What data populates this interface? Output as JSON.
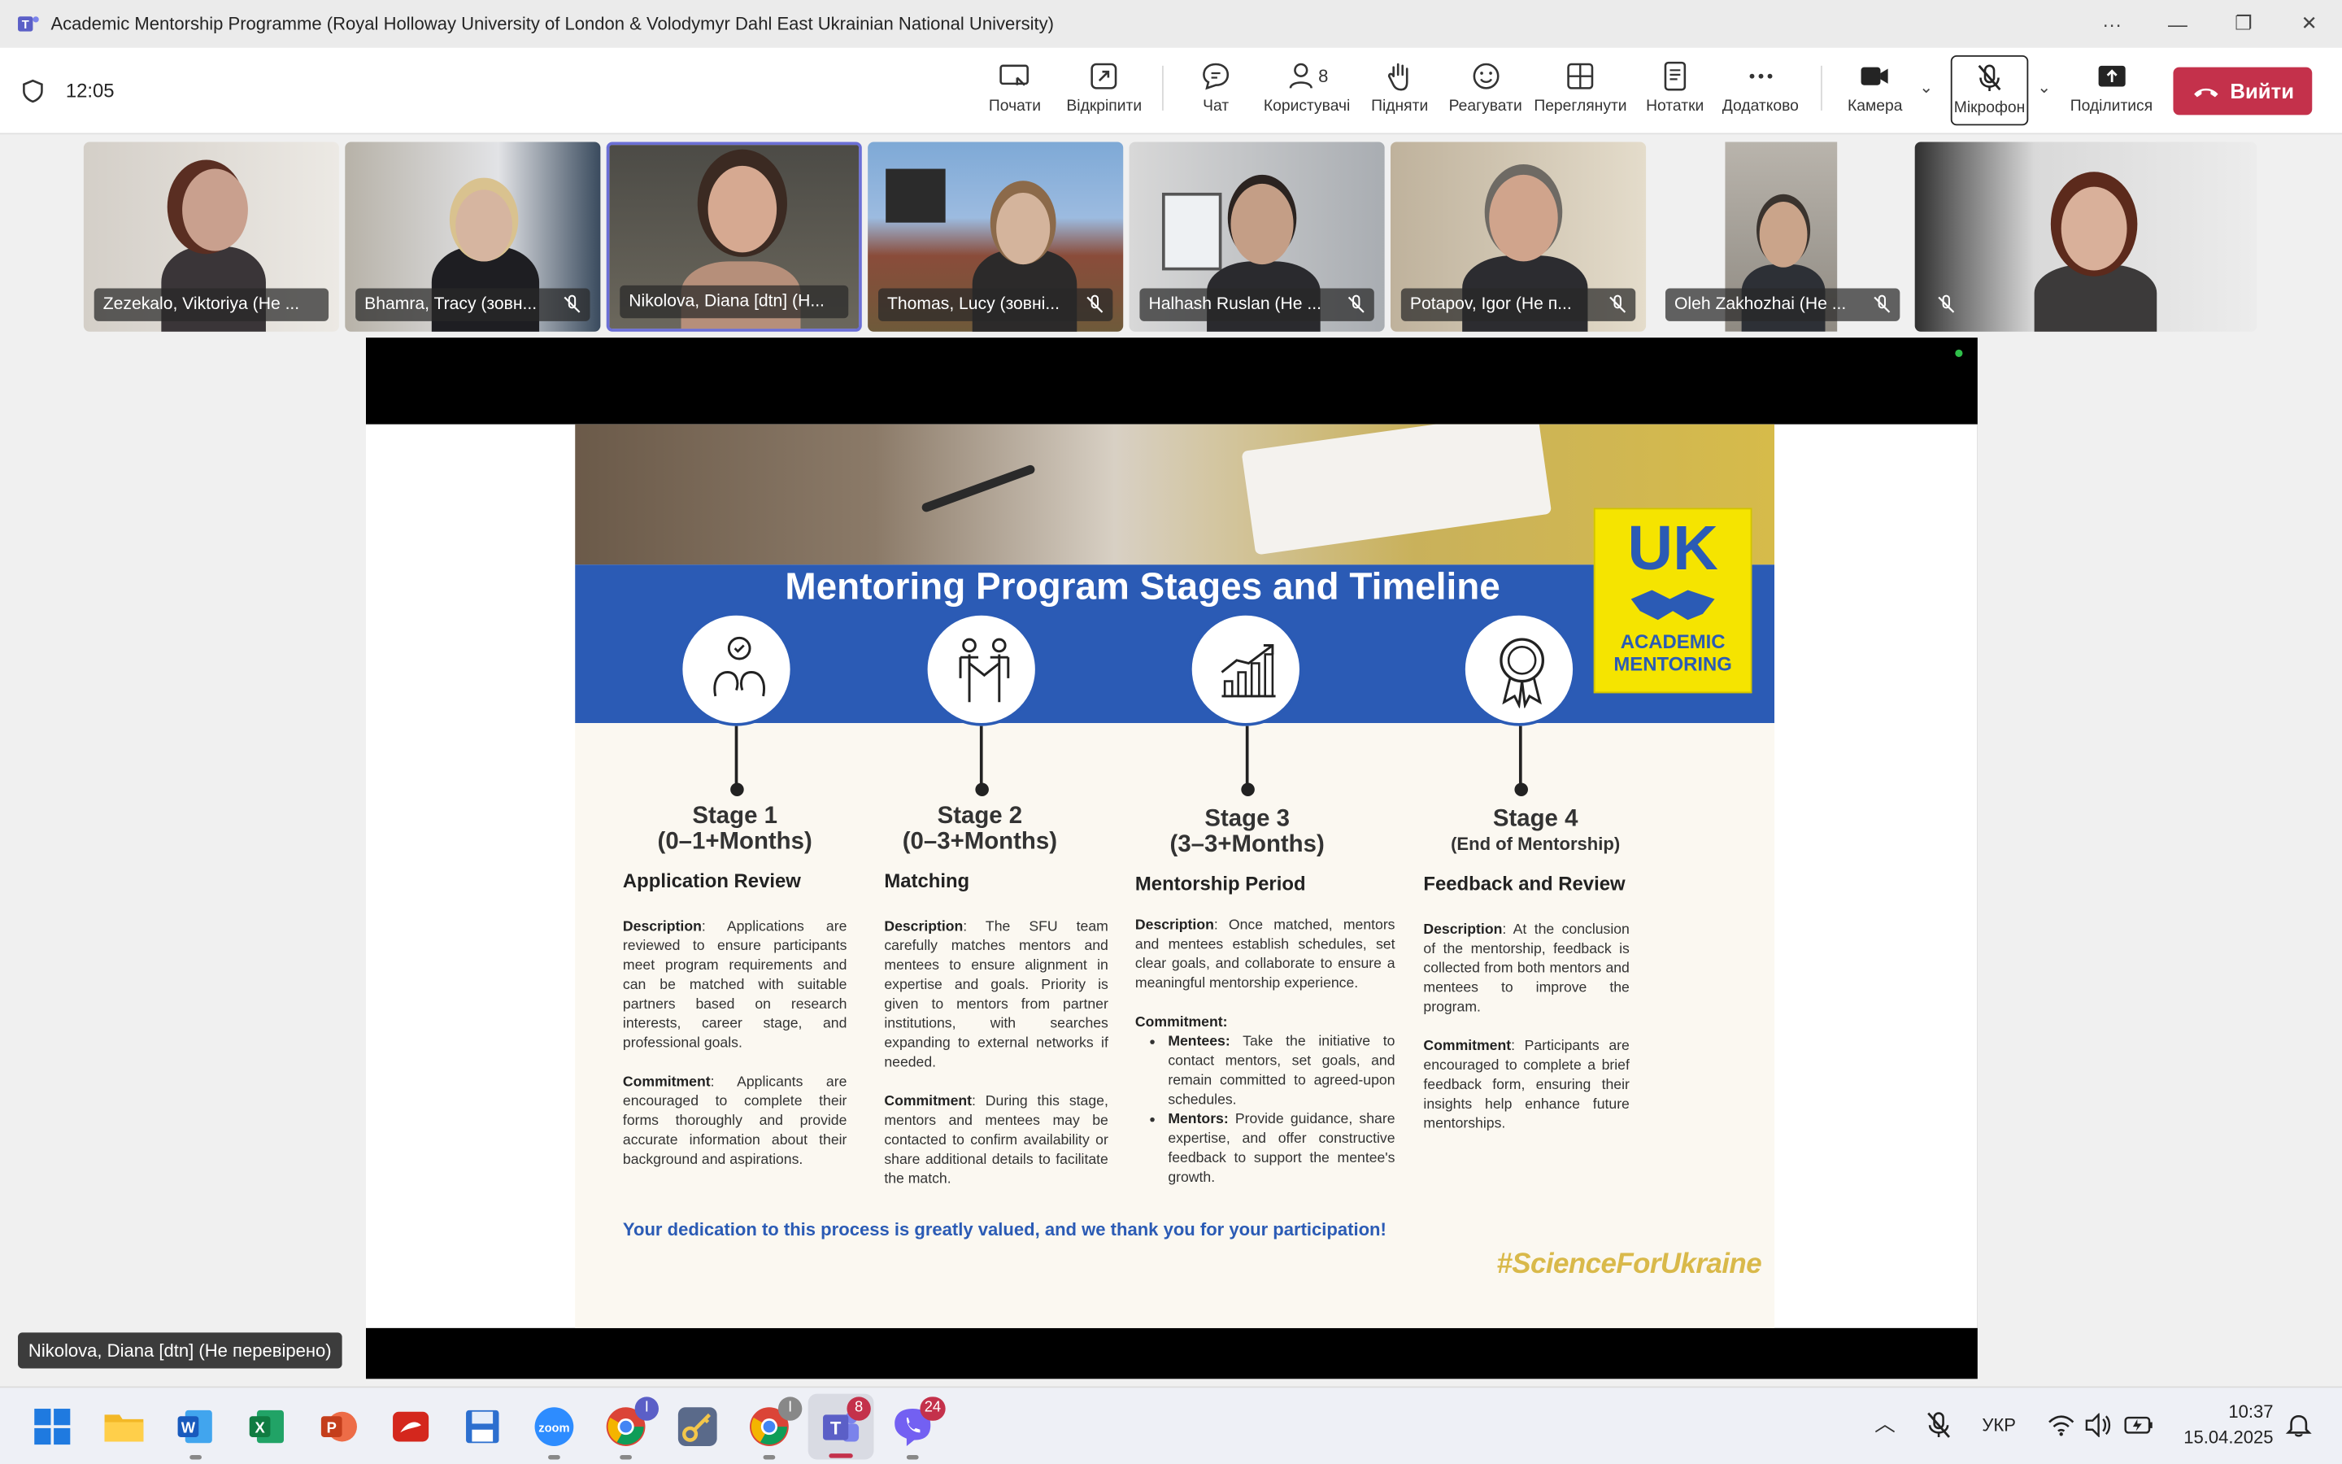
{
  "window": {
    "title": "Academic Mentorship Programme (Royal Holloway University of London & Volodymyr Dahl East Ukrainian National University)"
  },
  "meeting": {
    "timer": "12:05",
    "people_count": "8"
  },
  "toolbar": {
    "items": [
      {
        "label": "Почати",
        "icon": "record-icon"
      },
      {
        "label": "Відкріпити",
        "icon": "popout-icon"
      },
      {
        "label": "Чат",
        "icon": "chat-icon"
      },
      {
        "label": "Користувачі",
        "icon": "people-icon"
      },
      {
        "label": "Підняти",
        "icon": "raise-hand-icon"
      },
      {
        "label": "Реагувати",
        "icon": "react-icon"
      },
      {
        "label": "Переглянути",
        "icon": "view-icon"
      },
      {
        "label": "Нотатки",
        "icon": "notes-icon"
      },
      {
        "label": "Додатково",
        "icon": "more-icon"
      },
      {
        "label": "Камера",
        "icon": "camera-icon"
      },
      {
        "label": "Мікрофон",
        "icon": "mic-off-icon"
      },
      {
        "label": "Поділитися",
        "icon": "share-icon"
      }
    ],
    "leave_label": "Вийти"
  },
  "participants": [
    {
      "name": "Zezekalo, Viktoriya (Не ...",
      "muted": false
    },
    {
      "name": "Bhamra, Tracy (зовн...",
      "muted": true
    },
    {
      "name": "Nikolova, Diana [dtn] (Н...",
      "muted": false,
      "active": true
    },
    {
      "name": "Thomas, Lucy (зовні...",
      "muted": true
    },
    {
      "name": "Halhash Ruslan (Не ...",
      "muted": true
    },
    {
      "name": "Potapov, Igor (Не п...",
      "muted": true
    },
    {
      "name": "Oleh Zakhozhai (Не ...",
      "muted": true
    },
    {
      "name": "",
      "muted": true
    }
  ],
  "slide": {
    "title": "Mentoring Program Stages and Timeline",
    "logo_big": "UK",
    "logo_small_1": "ACADEMIC",
    "logo_small_2": "MENTORING",
    "stages": [
      {
        "number": "Stage 1",
        "period": "(0–1+Months)",
        "name": "Application Review",
        "description_label": "Description",
        "description": ": Applications are reviewed to ensure participants meet program requirements and can be matched with suitable partners based on research interests, career stage, and professional goals.",
        "commitment_label": "Commitment",
        "commitment": ": Applicants are encouraged to complete their forms thoroughly and provide accurate information about their background and aspirations."
      },
      {
        "number": "Stage 2",
        "period": "(0–3+Months)",
        "name": "Matching",
        "description_label": "Description",
        "description": ": The SFU team carefully matches mentors and mentees to ensure alignment in expertise and goals. Priority is given to mentors from partner institutions, with searches expanding to external networks if needed.",
        "commitment_label": "Commitment",
        "commitment": ": During this stage, mentors and mentees may be contacted to confirm availability or share additional details to facilitate the match."
      },
      {
        "number": "Stage 3",
        "period": "(3–3+Months)",
        "name": "Mentorship Period",
        "description_label": "Description",
        "description": ": Once matched, mentors and mentees establish schedules, set clear goals, and collaborate to ensure a meaningful mentorship experience.",
        "commitment_label": "Commitment:",
        "bullets": [
          {
            "label": "Mentees:",
            "text": " Take the initiative to contact mentors, set goals, and remain committed to agreed-upon schedules."
          },
          {
            "label": "Mentors:",
            "text": " Provide guidance, share expertise, and offer constructive feedback to support the mentee's growth."
          }
        ]
      },
      {
        "number": "Stage 4",
        "period": "(End of Mentorship)",
        "name": "Feedback and Review",
        "description_label": "Description",
        "description": ": At the conclusion of the mentorship, feedback is collected from both mentors and mentees to improve the program.",
        "commitment_label": "Commitment",
        "commitment": ": Participants are encouraged to complete a brief feedback form, ensuring their insights help enhance future mentorships."
      }
    ],
    "thanks": "Your dedication to this process is greatly valued, and we thank you for your participation!",
    "hashtag": "#ScienceForUkraine"
  },
  "presenter_label": "Nikolova, Diana [dtn] (Не перевірено)",
  "taskbar": {
    "badges": {
      "chrome": "I",
      "teams": "8",
      "viber": "24"
    },
    "language": "УКР",
    "time": "10:37",
    "date": "15.04.2025"
  },
  "colors": {
    "leave": "#c4314b",
    "slide_blue": "#2b5bb5",
    "logo_yellow": "#f5e400"
  }
}
